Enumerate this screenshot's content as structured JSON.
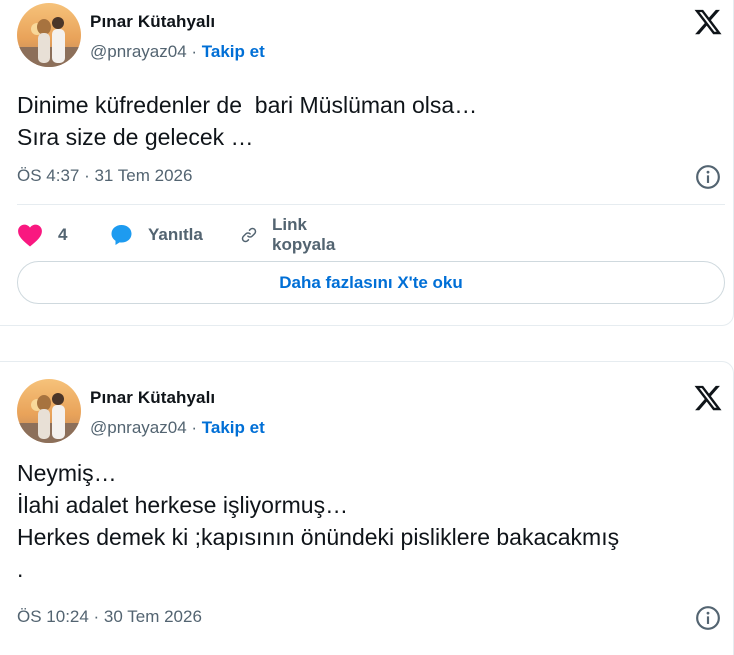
{
  "tweets": [
    {
      "author": "Pınar Kütahyalı",
      "handle": "@pnrayaz04",
      "separator": " · ",
      "follow_label": "Takip et",
      "text": "Dinime küfredenler de  bari Müslüman olsa…\nSıra size de gelecek …",
      "timestamp": "ÖS 4:37 · 31 Tem 2026",
      "like_count": "4",
      "reply_label": "Yanıtla",
      "copy_link_label": "Link kopyala",
      "read_more_label": "Daha fazlasını X'te oku"
    },
    {
      "author": "Pınar Kütahyalı",
      "handle": "@pnrayaz04",
      "separator": " · ",
      "follow_label": "Takip et",
      "text": "Neymiş…\nİlahi adalet herkese işliyormuş…\nHerkes demek ki ;kapısının önündeki pisliklere bakacakmış\n.",
      "timestamp": "ÖS 10:24 · 30 Tem 2026"
    }
  ],
  "colors": {
    "like": "#f91880",
    "reply": "#1d9bf0",
    "link": "#006fd6",
    "muted": "#536471"
  },
  "icons": [
    "x-logo-icon",
    "info-icon",
    "heart-icon",
    "reply-bubble-icon",
    "link-icon"
  ]
}
